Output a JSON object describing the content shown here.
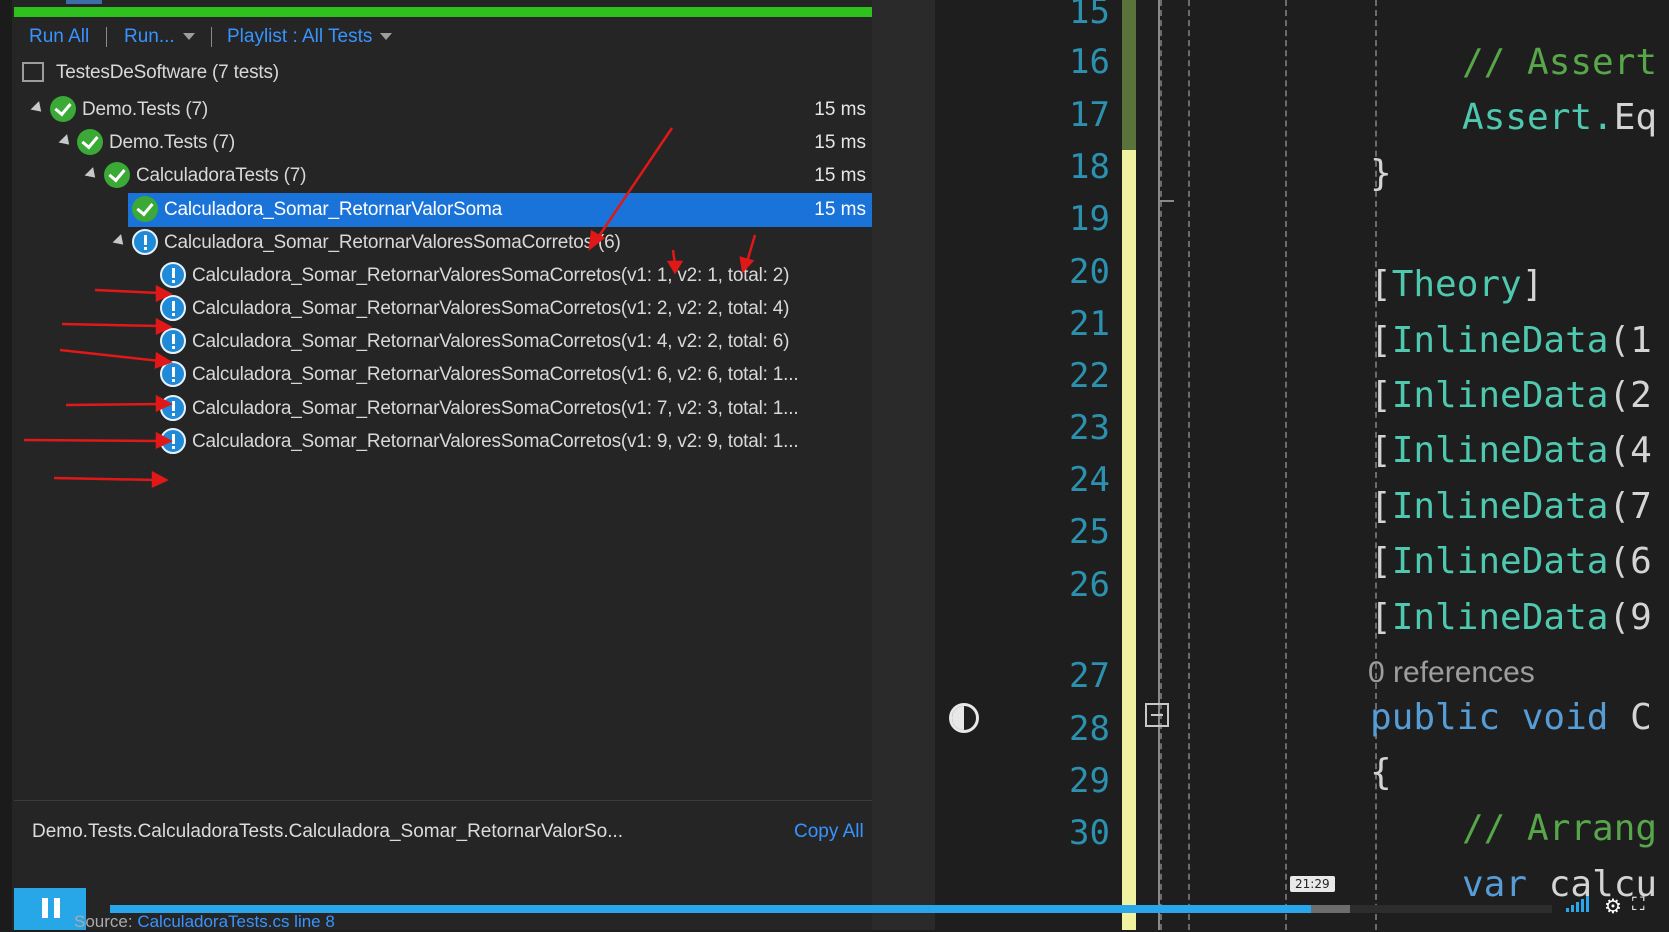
{
  "toolbar": {
    "run_all": "Run All",
    "run": "Run...",
    "playlist": "Playlist : All Tests"
  },
  "tree": {
    "project": "TestesDeSoftware (7 tests)",
    "rows": [
      {
        "label": "Demo.Tests (7)",
        "time": "15 ms",
        "status": "passed"
      },
      {
        "label": "Demo.Tests (7)",
        "time": "15 ms",
        "status": "passed"
      },
      {
        "label": "CalculadoraTests (7)",
        "time": "15 ms",
        "status": "passed"
      },
      {
        "label": "Calculadora_Somar_RetornarValorSoma",
        "time": "15 ms",
        "status": "passed",
        "selected": true
      },
      {
        "label": "Calculadora_Somar_RetornarValoresSomaCorretos (6)",
        "time": "",
        "status": "not-run"
      },
      {
        "label": "Calculadora_Somar_RetornarValoresSomaCorretos(v1: 1, v2: 1, total: 2)",
        "time": "",
        "status": "not-run"
      },
      {
        "label": "Calculadora_Somar_RetornarValoresSomaCorretos(v1: 2, v2: 2, total: 4)",
        "time": "",
        "status": "not-run"
      },
      {
        "label": "Calculadora_Somar_RetornarValoresSomaCorretos(v1: 4, v2: 2, total: 6)",
        "time": "",
        "status": "not-run"
      },
      {
        "label": "Calculadora_Somar_RetornarValoresSomaCorretos(v1: 6, v2: 6, total: 1...",
        "time": "",
        "status": "not-run"
      },
      {
        "label": "Calculadora_Somar_RetornarValoresSomaCorretos(v1: 7, v2: 3, total: 1...",
        "time": "",
        "status": "not-run"
      },
      {
        "label": "Calculadora_Somar_RetornarValoresSomaCorretos(v1: 9, v2: 9, total: 1...",
        "time": "",
        "status": "not-run"
      }
    ]
  },
  "details": {
    "title": "Demo.Tests.CalculadoraTests.Calculadora_Somar_RetornarValorSo...",
    "copy_all": "Copy All",
    "source_prefix": "Source:",
    "source_link": "CalculadoraTests.cs line 8"
  },
  "editor": {
    "line_numbers": [
      "15",
      "16",
      "17",
      "18",
      "19",
      "20",
      "21",
      "22",
      "23",
      "24",
      "25",
      "26",
      "27",
      "28",
      "29",
      "30"
    ],
    "lines": {
      "l16": "// Assert",
      "l17a": "Assert.",
      "l17b": "Eq",
      "l18": "}",
      "l20a": "[",
      "l20b": "Theory",
      "l20c": "]",
      "l21": "(1",
      "l22": "(2",
      "l23": "(4",
      "l24": "(7",
      "l25": "(6",
      "l26": "(9",
      "inline_data": "InlineData",
      "references": "0 references",
      "l27a": "public",
      "l27b": "void",
      "l27c": "C",
      "l28": "{",
      "l29": "// Arrang",
      "l30a": "var",
      "l30b": "calcu"
    }
  },
  "player": {
    "progress_fraction": 0.833,
    "buffered_fraction": 0.86,
    "time_tooltip": "21:29"
  },
  "colors": {
    "accent_blue": "#3794ff",
    "selection": "#1a73d9",
    "pass_green": "#3aa935",
    "not_run_blue": "#1f8ad8",
    "annotation_red": "#e01818"
  }
}
